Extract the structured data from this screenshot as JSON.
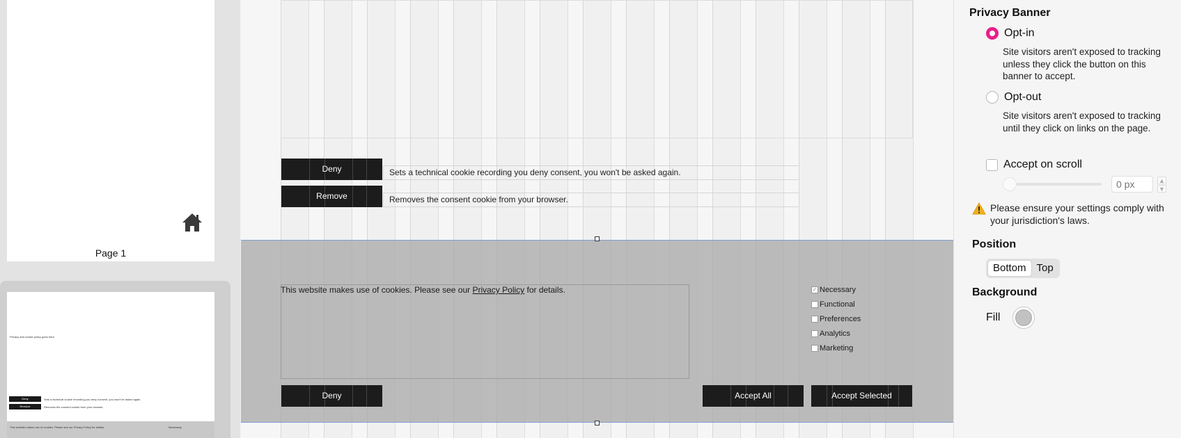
{
  "pages_panel": {
    "page1_label": "Page 1",
    "thumb2": {
      "text": "Privacy and cookie policy goes here.",
      "deny_label": "Deny",
      "deny_desc": "Sets a technical cookie recording you deny consent, you won't be asked again.",
      "remove_label": "Remove",
      "remove_desc": "Removes the consent cookie from your browser.",
      "banner_text": "This website makes use of cookies. Please see our Privacy Policy for details.",
      "banner_cat": "Necessary"
    }
  },
  "canvas": {
    "deny_button": "Deny",
    "deny_description": "Sets a technical cookie recording you deny consent, you won't be asked again.",
    "remove_button": "Remove",
    "remove_description": "Removes the consent cookie from your browser.",
    "banner": {
      "text_before": "This website makes use of cookies. Please see our ",
      "privacy_link": "Privacy Policy",
      "text_after": " for details.",
      "categories": [
        {
          "label": "Necessary",
          "checked": true
        },
        {
          "label": "Functional",
          "checked": false
        },
        {
          "label": "Preferences",
          "checked": false
        },
        {
          "label": "Analytics",
          "checked": false
        },
        {
          "label": "Marketing",
          "checked": false
        }
      ],
      "deny_button": "Deny",
      "accept_all_button": "Accept All",
      "accept_selected_button": "Accept Selected"
    }
  },
  "inspector": {
    "privacy_banner_heading": "Privacy Banner",
    "opt_in_label": "Opt-in",
    "opt_in_help": "Site visitors aren't exposed to tracking unless they click the button on this banner to accept.",
    "opt_out_label": "Opt-out",
    "opt_out_help": "Site visitors aren't exposed to tracking until they click on links on the page.",
    "selected_mode": "Opt-in",
    "accept_on_scroll_label": "Accept on scroll",
    "accept_on_scroll_checked": false,
    "scroll_px_placeholder": "0 px",
    "warning_text": "Please ensure your settings comply with your jurisdiction's laws.",
    "position_heading": "Position",
    "position_options": [
      "Bottom",
      "Top"
    ],
    "position_selected": "Bottom",
    "background_heading": "Background",
    "fill_label": "Fill",
    "fill_color": "#c2c2c2",
    "accent_color": "#e91e8c"
  }
}
